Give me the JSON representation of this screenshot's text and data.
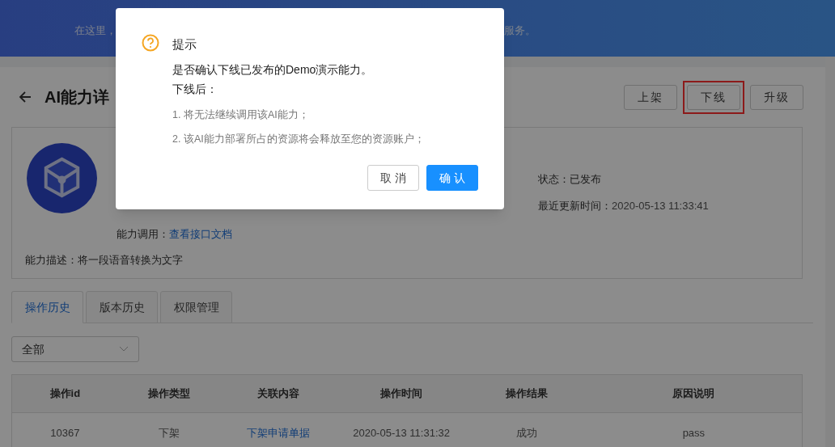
{
  "header": {
    "subtitle_left": "在这里，",
    "subtitle_right": "服务。"
  },
  "page": {
    "title": "AI能力详",
    "buttons": [
      {
        "label": "上架",
        "highlighted": false
      },
      {
        "label": "下线",
        "highlighted": true
      },
      {
        "label": "升级",
        "highlighted": false
      }
    ],
    "info": {
      "status_label": "状态：",
      "status_value": "已发布",
      "updated_label": "最近更新时间：",
      "updated_value": "2020-05-13 11:33:41",
      "call_label": "能力调用：",
      "call_link": "查看接口文档",
      "desc_label": "能力描述：",
      "desc_value": "将一段语音转换为文字"
    },
    "tabs": [
      {
        "label": "操作历史",
        "selected": true
      },
      {
        "label": "版本历史",
        "selected": false
      },
      {
        "label": "权限管理",
        "selected": false
      }
    ],
    "filter": {
      "value": "全部"
    },
    "table": {
      "columns": [
        "操作id",
        "操作类型",
        "关联内容",
        "操作时间",
        "操作结果",
        "原因说明"
      ],
      "rows": [
        [
          "10367",
          "下架",
          "下架申请单据",
          "2020-05-13 11:31:32",
          "成功",
          "pass"
        ]
      ]
    }
  },
  "dialog": {
    "title": "提示",
    "message": "是否确认下线已发布的Demo演示能力。",
    "subheading": "下线后：",
    "items": [
      "1. 将无法继续调用该AI能力；",
      "2. 该AI能力部署所占的资源将会释放至您的资源账户；"
    ],
    "buttons": [
      {
        "label": "取 消",
        "kind": "default"
      },
      {
        "label": "确 认",
        "kind": "primary"
      }
    ]
  }
}
